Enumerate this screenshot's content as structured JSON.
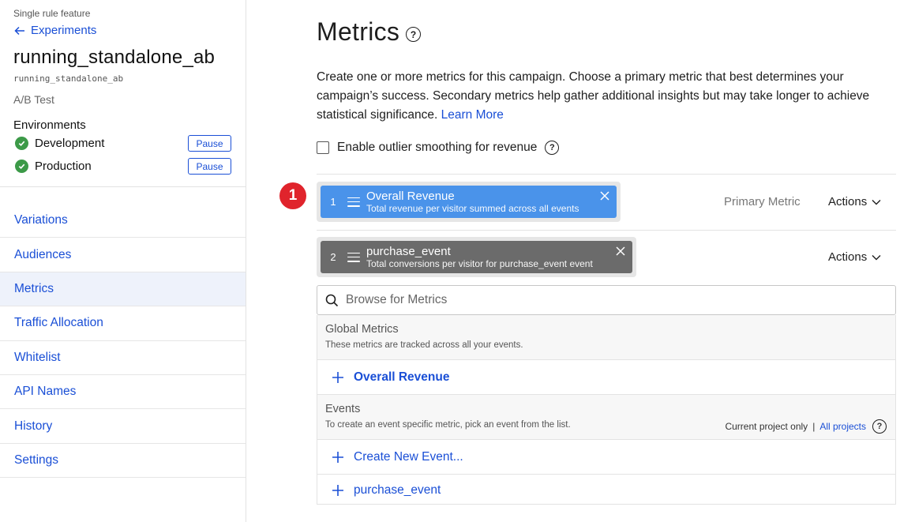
{
  "sidebar": {
    "kicker": "Single rule feature",
    "back_label": "Experiments",
    "experiment_name": "running_standalone_ab",
    "experiment_key": "running_standalone_ab",
    "experiment_type": "A/B Test",
    "environments_heading": "Environments",
    "environments": [
      {
        "name": "Development",
        "button": "Pause"
      },
      {
        "name": "Production",
        "button": "Pause"
      }
    ],
    "nav": [
      {
        "label": "Variations"
      },
      {
        "label": "Audiences"
      },
      {
        "label": "Metrics"
      },
      {
        "label": "Traffic Allocation"
      },
      {
        "label": "Whitelist"
      },
      {
        "label": "API Names"
      },
      {
        "label": "History"
      },
      {
        "label": "Settings"
      }
    ],
    "active_nav": "Metrics"
  },
  "main": {
    "title": "Metrics",
    "description": "Create one or more metrics for this campaign. Choose a primary metric that best determines your campaign’s success. Secondary metrics help gather additional insights but may take longer to achieve statistical significance.",
    "learn_more": "Learn More",
    "outlier_label": "Enable outlier smoothing for revenue",
    "badge": "1",
    "metrics": [
      {
        "index": "1",
        "name": "Overall Revenue",
        "description": "Total revenue per visitor summed across all events",
        "role": "Primary Metric",
        "actions": "Actions"
      },
      {
        "index": "2",
        "name": "purchase_event",
        "description": "Total conversions per visitor for purchase_event event",
        "role": "",
        "actions": "Actions"
      }
    ],
    "search": {
      "placeholder": "Browse for Metrics",
      "value": ""
    },
    "dropdown": {
      "global_heading": "Global Metrics",
      "global_sub": "These metrics are tracked across all your events.",
      "global_items": [
        "Overall Revenue"
      ],
      "events_heading": "Events",
      "events_sub": "To create an event specific metric, pick an event from the list.",
      "current_project": "Current project only",
      "separator": "|",
      "all_projects": "All projects",
      "create_event": "Create New Event...",
      "event_items": [
        "purchase_event"
      ]
    }
  },
  "colors": {
    "link": "#1a4fd6",
    "primary_pill": "#4a93ea",
    "secondary_pill": "#6b6b6b",
    "badge": "#e0242c",
    "check": "#3c9a48"
  }
}
